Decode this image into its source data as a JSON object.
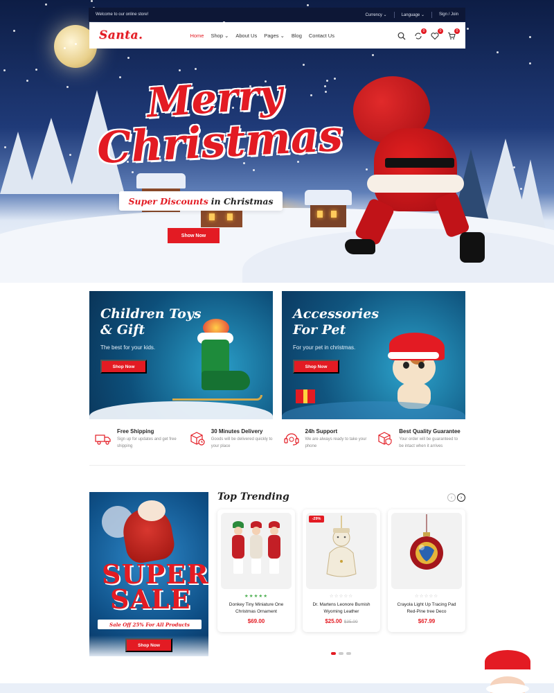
{
  "topbar": {
    "welcome": "Welcome to our online store!",
    "currency": "Currency ⌄",
    "language": "Language ⌄",
    "signin": "Sign / Join"
  },
  "nav": {
    "logo": "Santa.",
    "menu": [
      "Home",
      "Shop ⌄",
      "About Us",
      "Pages ⌄",
      "Blog",
      "Contact Us"
    ],
    "compare_count": "0",
    "wishlist_count": "0",
    "cart_count": "0"
  },
  "hero": {
    "line1": "Merry",
    "line2": "Christmas",
    "discount_red": "Super Discounts",
    "discount_rest": "in Christmas",
    "button": "Show Now"
  },
  "banners": [
    {
      "title": "Children Toys & Gift",
      "subtitle": "The best for your kids.",
      "button": "Shop Now"
    },
    {
      "title": "Accessories For Pet",
      "subtitle": "For your pet in christmas.",
      "button": "Shop Now"
    }
  ],
  "features": [
    {
      "title": "Free Shipping",
      "desc": "Sign up for updates and get free shipping",
      "icon": "truck-icon"
    },
    {
      "title": "30 Minutes Delivery",
      "desc": "Goods will be delivered quickly to your place",
      "icon": "box-clock-icon"
    },
    {
      "title": "24h Support",
      "desc": "We are always ready to take your phone",
      "icon": "headset-icon"
    },
    {
      "title": "Best Quality Guarantee",
      "desc": "Your order will be guaranteed to be intact when it arrives",
      "icon": "shield-box-icon"
    }
  ],
  "sale": {
    "line1": "SUPER",
    "line2": "SALE",
    "strip": "Sale Off 25% For All Products",
    "button": "Shop Now"
  },
  "trending": {
    "title": "Top Trending",
    "products": [
      {
        "name": "Donkey Tiny Miniature One Christmas Ornament",
        "price": "$69.00",
        "old_price": "",
        "badge": "",
        "stars": "★★★★★",
        "rating": 5
      },
      {
        "name": "Dr. Martens Leonore Burnish Wyoming Leather",
        "price": "$25.00",
        "old_price": "$35.00",
        "badge": "-29%",
        "stars": "☆☆☆☆☆",
        "rating": 0
      },
      {
        "name": "Crayola Light Up Tracing Pad Red-Pine tree Deco",
        "price": "$67.99",
        "old_price": "",
        "badge": "",
        "stars": "☆☆☆☆☆",
        "rating": 0
      }
    ]
  },
  "colors": {
    "accent": "#e31b23",
    "navy": "#0d1736"
  }
}
